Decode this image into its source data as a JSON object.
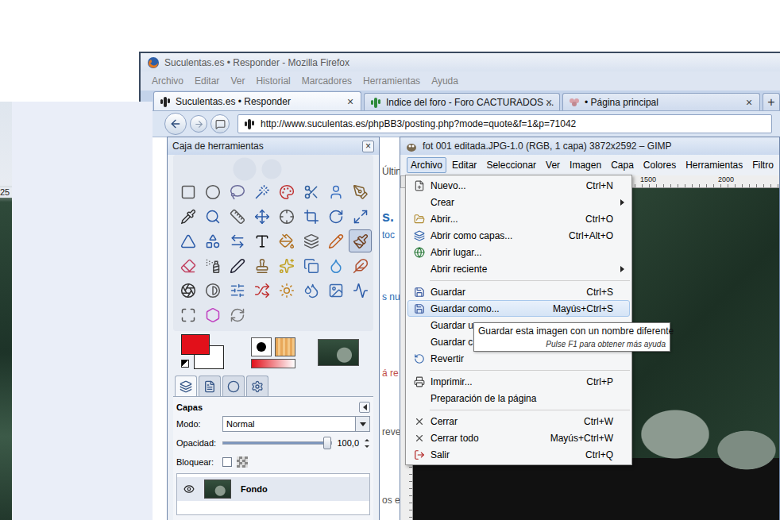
{
  "desktop": {
    "left_fragment": "25"
  },
  "firefox": {
    "title": "Suculentas.es • Responder - Mozilla Firefox",
    "menu": [
      "Archivo",
      "Editar",
      "Ver",
      "Historial",
      "Marcadores",
      "Herramientas",
      "Ayuda"
    ],
    "tabs": [
      {
        "label": "Suculentas.es • Responder",
        "close": "×",
        "selected": true
      },
      {
        "label": "Indice del foro - Foro CACTURADOS ...",
        "close": "×",
        "selected": false
      },
      {
        "label": "• Página principal",
        "close": "×",
        "selected": false
      }
    ],
    "new_tab": "+",
    "url": "http://www.suculentas.es/phpBB3/posting.php?mode=quote&f=1&p=71042",
    "page_fragments": [
      {
        "text": "Últin",
        "color": "#444444"
      },
      {
        "text": "s.",
        "color": "#2a6db5"
      },
      {
        "text": "toc",
        "color": "#2a6db5"
      },
      {
        "text": "s nu",
        "color": "#2a6db5"
      },
      {
        "text": "á re",
        "color": "#c0504d"
      },
      {
        "text": "reve",
        "color": "#555555"
      },
      {
        "text": "os e",
        "color": "#555555"
      }
    ]
  },
  "toolbox": {
    "title": "Caja de herramientas",
    "close": "×",
    "tools": [
      {
        "selected": false
      },
      {
        "selected": false
      },
      {
        "selected": false
      },
      {
        "selected": false
      },
      {
        "selected": false
      },
      {
        "selected": false
      },
      {
        "selected": false
      },
      {
        "selected": false
      },
      {
        "selected": false
      },
      {
        "selected": false
      },
      {
        "selected": false
      },
      {
        "selected": false
      },
      {
        "selected": false
      },
      {
        "selected": false
      },
      {
        "selected": false
      },
      {
        "selected": false
      },
      {
        "selected": false
      },
      {
        "selected": false
      },
      {
        "selected": false
      },
      {
        "selected": false
      },
      {
        "selected": false
      },
      {
        "selected": false
      },
      {
        "selected": false
      },
      {
        "selected": true
      },
      {
        "selected": false
      },
      {
        "selected": false
      },
      {
        "selected": false
      },
      {
        "selected": false
      },
      {
        "selected": false
      },
      {
        "selected": false
      },
      {
        "selected": false
      },
      {
        "selected": false
      },
      {
        "selected": false
      },
      {
        "selected": false
      },
      {
        "selected": false
      },
      {
        "selected": false
      },
      {
        "selected": false
      },
      {
        "selected": false
      },
      {
        "selected": false
      },
      {
        "selected": false
      },
      {
        "selected": false
      },
      {
        "selected": false
      },
      {
        "selected": false
      }
    ],
    "foreground": "#e2101a",
    "background": "#ffffff",
    "dock_tabs": [
      {
        "selected": true
      },
      {
        "selected": false
      },
      {
        "selected": false
      },
      {
        "selected": false
      }
    ],
    "layers_panel": {
      "title": "Capas",
      "mode_label": "Modo:",
      "mode": "Normal",
      "opacity_label": "Opacidad:",
      "opacity": "100,0",
      "opacity_level": 1,
      "lock_label": "Bloquear:",
      "lock_checked": false,
      "layers": [
        {
          "name": "Fondo",
          "visible": true,
          "selected": true
        }
      ]
    }
  },
  "image_window": {
    "title": "fot 001 editada.JPG-1.0 (RGB, 1 capa) 3872x2592 – GIMP",
    "menu": [
      {
        "label": "Archivo",
        "selected": true
      },
      {
        "label": "Editar",
        "selected": false
      },
      {
        "label": "Seleccionar",
        "selected": false
      },
      {
        "label": "Ver",
        "selected": false
      },
      {
        "label": "Imagen",
        "selected": false
      },
      {
        "label": "Capa",
        "selected": false
      },
      {
        "label": "Colores",
        "selected": false
      },
      {
        "label": "Herramientas",
        "selected": false
      },
      {
        "label": "Filtro",
        "selected": false
      }
    ],
    "ruler_ticks": [
      "1500",
      "2000"
    ]
  },
  "file_menu": {
    "items": [
      {
        "kind": "item",
        "label": "Nuevo...",
        "shortcut": "Ctrl+N",
        "submenu": false,
        "selected": false
      },
      {
        "kind": "item",
        "label": "Crear",
        "shortcut": "",
        "submenu": true,
        "selected": false
      },
      {
        "kind": "item",
        "label": "Abrir...",
        "shortcut": "Ctrl+O",
        "submenu": false,
        "selected": false
      },
      {
        "kind": "item",
        "label": "Abrir como capas...",
        "shortcut": "Ctrl+Alt+O",
        "submenu": false,
        "selected": false
      },
      {
        "kind": "item",
        "label": "Abrir lugar...",
        "shortcut": "",
        "submenu": false,
        "selected": false
      },
      {
        "kind": "item",
        "label": "Abrir reciente",
        "shortcut": "",
        "submenu": true,
        "selected": false
      },
      {
        "kind": "separator"
      },
      {
        "kind": "item",
        "label": "Guardar",
        "shortcut": "Ctrl+S",
        "submenu": false,
        "selected": false
      },
      {
        "kind": "item",
        "label": "Guardar como...",
        "shortcut": "Mayús+Ctrl+S",
        "submenu": false,
        "selected": true
      },
      {
        "kind": "item",
        "label": "Guardar u",
        "shortcut": "",
        "submenu": false,
        "selected": false
      },
      {
        "kind": "item",
        "label": "Guardar c",
        "shortcut": "",
        "submenu": false,
        "selected": false
      },
      {
        "kind": "item",
        "label": "Revertir",
        "shortcut": "",
        "submenu": false,
        "selected": false
      },
      {
        "kind": "separator"
      },
      {
        "kind": "item",
        "label": "Imprimir...",
        "shortcut": "Ctrl+P",
        "submenu": false,
        "selected": false
      },
      {
        "kind": "item",
        "label": "Preparación de la página",
        "shortcut": "",
        "submenu": false,
        "selected": false
      },
      {
        "kind": "separator"
      },
      {
        "kind": "item",
        "label": "Cerrar",
        "shortcut": "Ctrl+W",
        "submenu": false,
        "selected": false
      },
      {
        "kind": "item",
        "label": "Cerrar todo",
        "shortcut": "Mayús+Ctrl+W",
        "submenu": false,
        "selected": false
      },
      {
        "kind": "item",
        "label": "Salir",
        "shortcut": "Ctrl+Q",
        "submenu": false,
        "selected": false
      }
    ]
  },
  "tooltip": {
    "text": "Guardar esta imagen con un nombre diferente",
    "hint": "Pulse F1 para obtener más ayuda"
  }
}
